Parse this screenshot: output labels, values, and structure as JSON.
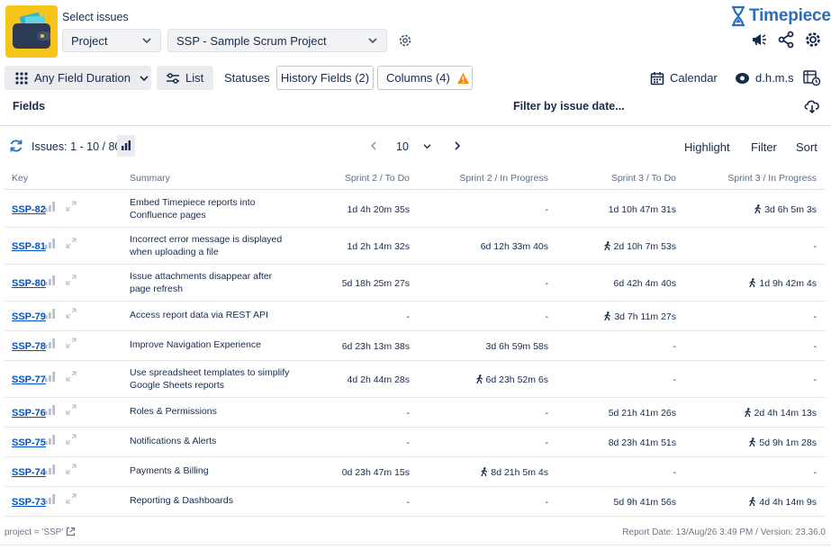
{
  "header": {
    "select_label": "Select issues",
    "project_dropdown": "Project",
    "ssp_dropdown": "SSP - Sample Scrum Project",
    "brand_name": "Timepiece"
  },
  "toolbar": {
    "duration": "Any Field Duration",
    "list": "List",
    "statuses": "Statuses",
    "history_fields": "History Fields (2)",
    "columns": "Columns (4)",
    "calendar": "Calendar",
    "dhms": "d.h.m.s"
  },
  "filters": {
    "fields": "Fields",
    "filter_by_date": "Filter by issue date..."
  },
  "issues_bar": {
    "count": "Issues: 1 - 10 / 80",
    "page_size": "10",
    "highlight": "Highlight",
    "filter": "Filter",
    "sort": "Sort"
  },
  "table": {
    "headers": [
      "Key",
      "Summary",
      "Sprint 2 / To Do",
      "Sprint 2 / In Progress",
      "Sprint 3 / To Do",
      "Sprint 3 / In Progress"
    ],
    "rows": [
      {
        "key": "SSP-82",
        "summary": "Embed Timepiece reports into Confluence pages",
        "c1": "1d 4h 20m 35s",
        "c2": "-",
        "c3": "1d 10h 47m 31s",
        "c4": "3d 6h 5m 3s",
        "w": [
          false,
          false,
          false,
          true
        ]
      },
      {
        "key": "SSP-81",
        "summary": "Incorrect error message is displayed when uploading a file",
        "c1": "1d 2h 14m 32s",
        "c2": "6d 12h 33m 40s",
        "c3": "2d 10h 7m 53s",
        "c4": "-",
        "w": [
          false,
          false,
          true,
          false
        ]
      },
      {
        "key": "SSP-80",
        "summary": "Issue attachments disappear after page refresh",
        "c1": "5d 18h 25m 27s",
        "c2": "-",
        "c3": "6d 42h 4m 40s",
        "c4": "1d 9h 42m 4s",
        "w": [
          false,
          false,
          false,
          true
        ]
      },
      {
        "key": "SSP-79",
        "summary": "Access report data via REST API",
        "c1": "-",
        "c2": "-",
        "c3": "3d 7h 11m 27s",
        "c4": "-",
        "w": [
          false,
          false,
          true,
          false
        ]
      },
      {
        "key": "SSP-78",
        "summary": "Improve Navigation Experience",
        "c1": "6d 23h 13m 38s",
        "c2": "3d 6h 59m 58s",
        "c3": "-",
        "c4": "-",
        "w": [
          false,
          false,
          false,
          false
        ]
      },
      {
        "key": "SSP-77",
        "summary": "Use spreadsheet templates to simplify Google Sheets reports",
        "c1": "4d 2h 44m 28s",
        "c2": "6d 23h 52m 6s",
        "c3": "-",
        "c4": "-",
        "w": [
          false,
          true,
          false,
          false
        ]
      },
      {
        "key": "SSP-76",
        "summary": "Roles & Permissions",
        "c1": "-",
        "c2": "-",
        "c3": "5d 21h 41m 26s",
        "c4": "2d 4h 14m 13s",
        "w": [
          false,
          false,
          false,
          true
        ]
      },
      {
        "key": "SSP-75",
        "summary": "Notifications & Alerts",
        "c1": "-",
        "c2": "-",
        "c3": "8d 23h 41m 51s",
        "c4": "5d 9h 1m 28s",
        "w": [
          false,
          false,
          false,
          true
        ]
      },
      {
        "key": "SSP-74",
        "summary": "Payments & Billing",
        "c1": "0d 23h 47m 15s",
        "c2": "8d 21h 5m 4s",
        "c3": "-",
        "c4": "-",
        "w": [
          false,
          true,
          false,
          false
        ]
      },
      {
        "key": "SSP-73",
        "summary": "Reporting & Dashboards",
        "c1": "-",
        "c2": "-",
        "c3": "5d 9h 41m 56s",
        "c4": "4d 4h 14m 9s",
        "w": [
          false,
          false,
          false,
          true
        ]
      }
    ]
  },
  "footer": {
    "query": "project = 'SSP'",
    "report_info": "Report Date: 13/Aug/26 3:49 PM / Version: 23.36.0"
  },
  "colors": {
    "accent": "#2a6ebb",
    "link": "#0052cc",
    "app_icon_bg": "#f7c51a",
    "warning": "#ff8b00"
  }
}
